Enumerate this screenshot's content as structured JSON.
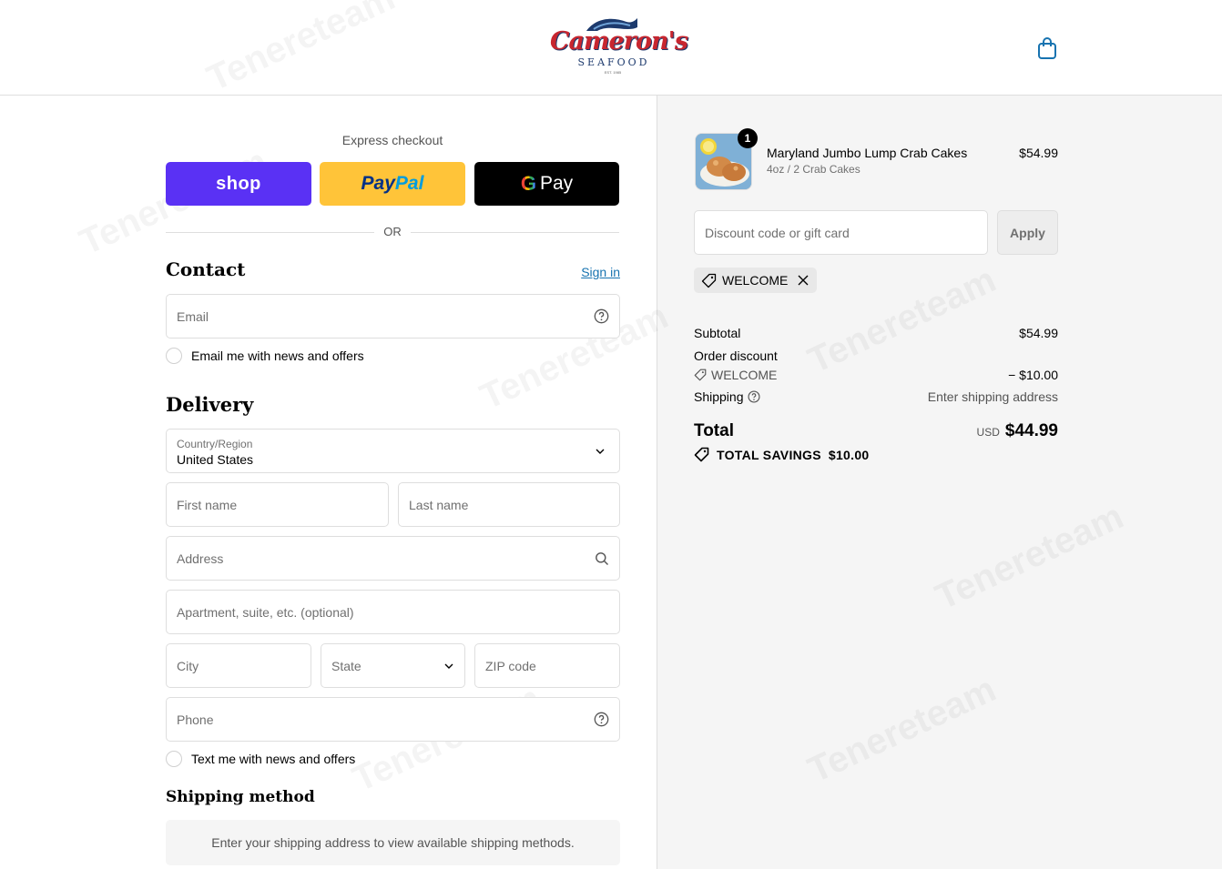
{
  "header": {
    "logo_text": "Cameron's",
    "logo_sub": "SEAFOOD",
    "logo_est": "EST. 1985",
    "cart_icon": "bag-icon"
  },
  "express": {
    "title": "Express checkout",
    "shop_label": "shop",
    "paypal_part1": "Pay",
    "paypal_part2": "Pal",
    "gpay_g": "G",
    "gpay_label": "Pay",
    "or_label": "OR"
  },
  "contact": {
    "title": "Contact",
    "signin_label": "Sign in",
    "email_placeholder": "Email",
    "news_checkbox_label": "Email me with news and offers"
  },
  "delivery": {
    "title": "Delivery",
    "country_label": "Country/Region",
    "country_value": "United States",
    "first_name_placeholder": "First name",
    "last_name_placeholder": "Last name",
    "address_placeholder": "Address",
    "apartment_placeholder": "Apartment, suite, etc. (optional)",
    "city_placeholder": "City",
    "state_placeholder": "State",
    "zip_placeholder": "ZIP code",
    "phone_placeholder": "Phone",
    "text_checkbox_label": "Text me with news and offers"
  },
  "shipping": {
    "title": "Shipping method",
    "message": "Enter your shipping address to view available shipping methods."
  },
  "summary": {
    "product": {
      "name": "Maryland Jumbo Lump Crab Cakes",
      "variant": "4oz / 2 Crab Cakes",
      "price": "$54.99",
      "quantity": "1"
    },
    "discount_placeholder": "Discount code or gift card",
    "apply_label": "Apply",
    "applied_code": "WELCOME",
    "subtotal_label": "Subtotal",
    "subtotal_value": "$54.99",
    "order_discount_label": "Order discount",
    "order_discount_code": "WELCOME",
    "order_discount_value": "− $10.00",
    "shipping_label": "Shipping",
    "shipping_value": "Enter shipping address",
    "total_label": "Total",
    "total_currency": "USD",
    "total_value": "$44.99",
    "savings_label": "TOTAL SAVINGS",
    "savings_value": "$10.00"
  },
  "watermark": "Tenereteam",
  "colors": {
    "shop_purple": "#5a31f4",
    "paypal_yellow": "#ffc439",
    "link_blue": "#1773b0",
    "brand_red": "#c8262f",
    "brand_navy": "#1d3a6d"
  }
}
